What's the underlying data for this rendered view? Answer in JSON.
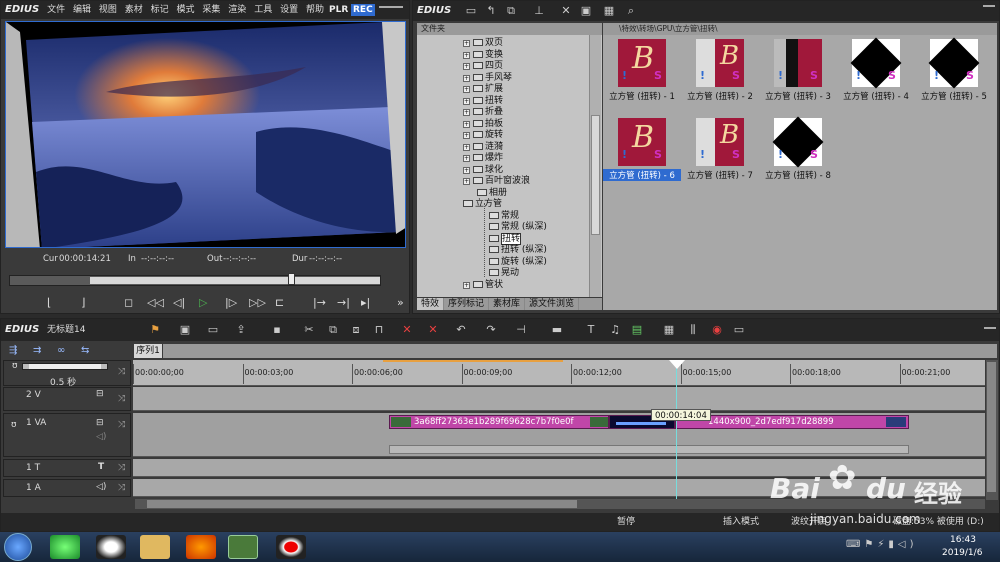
{
  "app": {
    "logo": "EDIUS",
    "menu": [
      "文件",
      "编辑",
      "视图",
      "素材",
      "标记",
      "模式",
      "采集",
      "渲染",
      "工具",
      "设置",
      "帮助"
    ],
    "plr": "PLR",
    "rec": "REC"
  },
  "player": {
    "cur_label": "Cur",
    "cur": "00:00:14:21",
    "in_label": "In",
    "in": "--:--:--:--",
    "out_label": "Out",
    "out": "--:--:--:--",
    "dur_label": "Dur",
    "dur": "--:--:--:--"
  },
  "bin": {
    "logo": "EDIUS",
    "folder_header": "文件夹",
    "path": "\\特效\\转场\\GPU\\立方管\\扭转\\",
    "tree": [
      {
        "label": "双页",
        "plus": true
      },
      {
        "label": "变换",
        "plus": true
      },
      {
        "label": "四页",
        "plus": true
      },
      {
        "label": "手风琴",
        "plus": true
      },
      {
        "label": "扩展",
        "plus": true
      },
      {
        "label": "扭转",
        "plus": true
      },
      {
        "label": "折叠",
        "plus": true
      },
      {
        "label": "拍板",
        "plus": true
      },
      {
        "label": "旋转",
        "plus": true
      },
      {
        "label": "涟漪",
        "plus": true
      },
      {
        "label": "爆炸",
        "plus": true
      },
      {
        "label": "球化",
        "plus": true
      },
      {
        "label": "百叶窗波浪",
        "plus": true
      },
      {
        "label": "相册",
        "plus": false
      },
      {
        "label": "立方管",
        "plus": false
      },
      {
        "label": "常规",
        "plus": false
      },
      {
        "label": "常规 (纵深)",
        "plus": false
      },
      {
        "label": "扭转",
        "plus": false
      },
      {
        "label": "扭转 (纵深)",
        "plus": false
      },
      {
        "label": "旋转 (纵深)",
        "plus": false
      },
      {
        "label": "晃动",
        "plus": false
      },
      {
        "label": "管状",
        "plus": true
      }
    ],
    "items": [
      "立方管 (扭转) - 1",
      "立方管 (扭转) - 2",
      "立方管 (扭转) - 3",
      "立方管 (扭转) - 4",
      "立方管 (扭转) - 5",
      "立方管 (扭转) - 6",
      "立方管 (扭转) - 7",
      "立方管 (扭转) - 8"
    ],
    "tabs": [
      "特效",
      "序列标记",
      "素材库",
      "源文件浏览"
    ],
    "thumb_letter_b": "B",
    "thumb_letter_s": "S",
    "thumb_mark": "!"
  },
  "timeline": {
    "logo": "EDIUS",
    "project": "无标题14",
    "sequence_tab": "序列1",
    "zoom": "0.5 秒",
    "ruler": [
      "00:00:00;00",
      "00:00:03;00",
      "00:00:06;00",
      "00:00:09;00",
      "00:00:12;00",
      "00:00:15;00",
      "00:00:18;00",
      "00:00:21;00"
    ],
    "tracks": [
      {
        "name": "2 V"
      },
      {
        "name": "1 VA"
      },
      {
        "name": "1 T"
      },
      {
        "name": "1 A"
      }
    ],
    "clip1": "3a68ff27363e1b289f69628c7b7f0e0f",
    "clip2": "1440x900_2d7edf917d28899",
    "tooltip": "00:00:14:04",
    "status": {
      "state": "暂停",
      "mode": "插入模式",
      "ripple": "波纹开启",
      "disk": "磁盘:53% 被使用 (D:)"
    }
  },
  "taskbar": {
    "time": "16:43",
    "date": "2019/1/6"
  },
  "watermark": {
    "brand": "Bai",
    "du": "du",
    "cn": "经验",
    "url": "jingyan.baidu.com"
  },
  "colors": {
    "accent": "#2f6bd0",
    "clip": "#c046a8",
    "bin_bg": "#a8a8a8",
    "timeline_bg": "#a0a0a0"
  }
}
